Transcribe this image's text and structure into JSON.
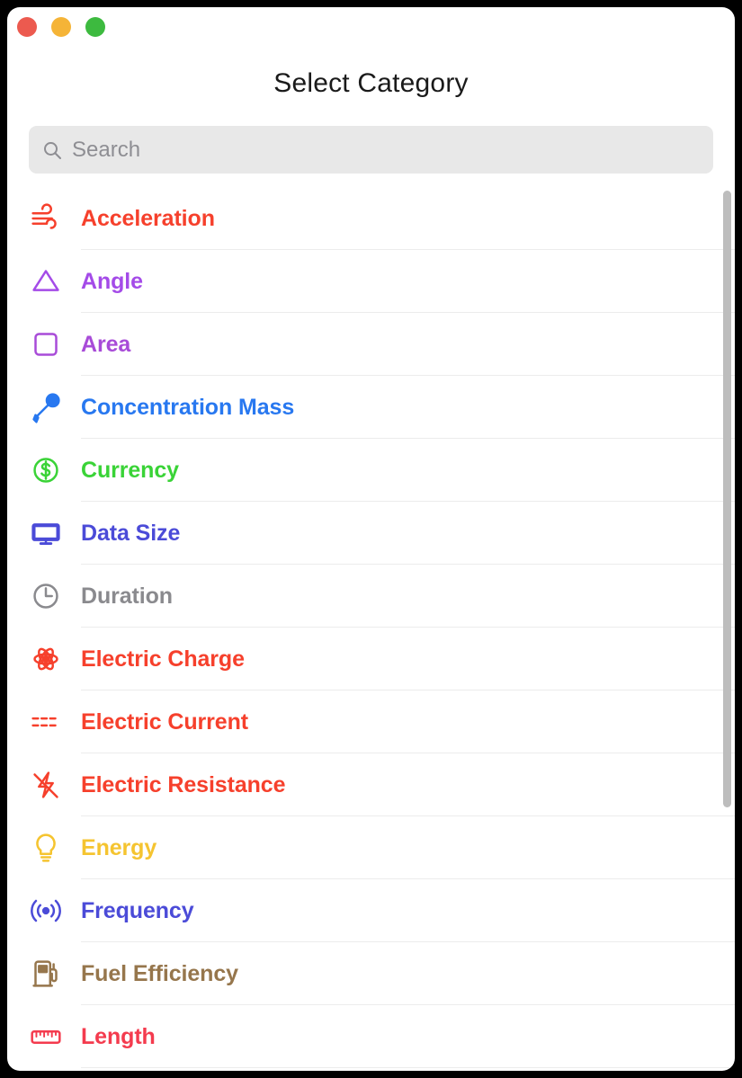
{
  "window": {
    "title": "Select Category",
    "traffic_lights": [
      {
        "name": "close",
        "color": "#ec5a4f"
      },
      {
        "name": "minimize",
        "color": "#f5b437"
      },
      {
        "name": "zoom",
        "color": "#3dba3f"
      }
    ]
  },
  "search": {
    "placeholder": "Search",
    "value": "",
    "icon": "search-icon"
  },
  "categories": [
    {
      "label": "Acceleration",
      "color": "#f6402c",
      "icon": "wind-icon"
    },
    {
      "label": "Angle",
      "color": "#a44be8",
      "icon": "triangle-icon"
    },
    {
      "label": "Area",
      "color": "#a84bd8",
      "icon": "square-icon"
    },
    {
      "label": "Concentration Mass",
      "color": "#2878f0",
      "icon": "eyedropper-icon"
    },
    {
      "label": "Currency",
      "color": "#3ad337",
      "icon": "dollar-circle-icon"
    },
    {
      "label": "Data Size",
      "color": "#4b4bd8",
      "icon": "monitor-icon"
    },
    {
      "label": "Duration",
      "color": "#8a8a8e",
      "icon": "clock-icon"
    },
    {
      "label": "Electric Charge",
      "color": "#f6402c",
      "icon": "atom-icon"
    },
    {
      "label": "Electric Current",
      "color": "#f6402c",
      "icon": "dashed-lines-icon"
    },
    {
      "label": "Electric Resistance",
      "color": "#f6402c",
      "icon": "bolt-slash-icon"
    },
    {
      "label": "Energy",
      "color": "#f5c430",
      "icon": "lightbulb-icon"
    },
    {
      "label": "Frequency",
      "color": "#4b4bd8",
      "icon": "broadcast-icon"
    },
    {
      "label": "Fuel Efficiency",
      "color": "#96764c",
      "icon": "fuel-pump-icon"
    },
    {
      "label": "Length",
      "color": "#f43b4e",
      "icon": "ruler-icon"
    }
  ],
  "scrollbar": {
    "orientation": "vertical",
    "thumb_color": "#bdbdbd"
  }
}
